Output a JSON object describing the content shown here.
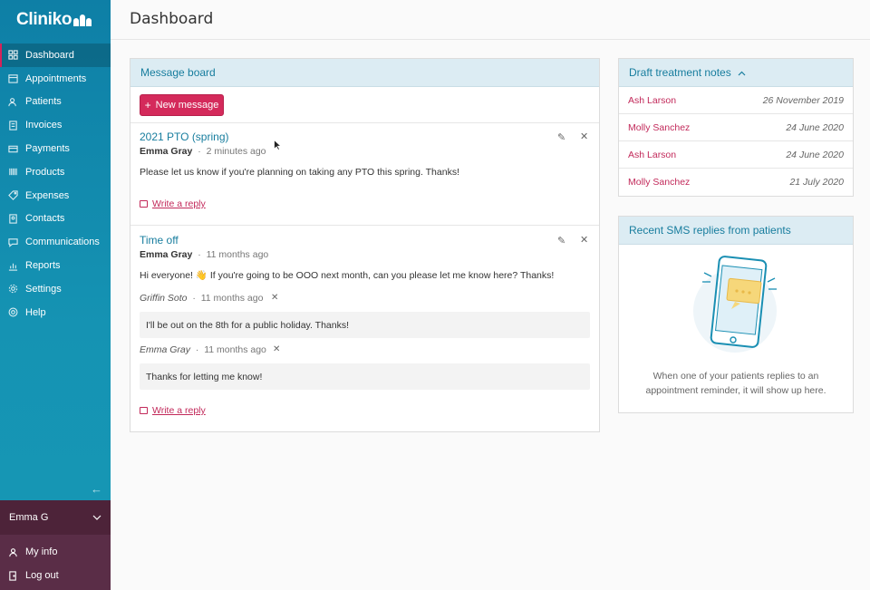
{
  "app": {
    "name": "Cliniko"
  },
  "sidebar": {
    "items": [
      {
        "label": "Dashboard",
        "icon": "grid-icon",
        "active": true
      },
      {
        "label": "Appointments",
        "icon": "calendar-icon"
      },
      {
        "label": "Patients",
        "icon": "users-icon"
      },
      {
        "label": "Invoices",
        "icon": "invoice-icon"
      },
      {
        "label": "Payments",
        "icon": "card-icon"
      },
      {
        "label": "Products",
        "icon": "barcode-icon"
      },
      {
        "label": "Expenses",
        "icon": "tag-icon"
      },
      {
        "label": "Contacts",
        "icon": "contacts-icon"
      },
      {
        "label": "Communications",
        "icon": "chat-icon"
      },
      {
        "label": "Reports",
        "icon": "chart-icon"
      },
      {
        "label": "Settings",
        "icon": "gear-icon"
      },
      {
        "label": "Help",
        "icon": "help-icon"
      }
    ],
    "user": {
      "name": "Emma G",
      "my_info": "My info",
      "logout": "Log out"
    }
  },
  "header": {
    "title": "Dashboard"
  },
  "message_board": {
    "title": "Message board",
    "new_button": "New message",
    "separator": "·",
    "messages": [
      {
        "title": "2021 PTO (spring)",
        "author": "Emma Gray",
        "time": "2 minutes ago",
        "body": "Please let us know if you're planning on taking any PTO this spring. Thanks!",
        "reply_label": "Write a reply"
      },
      {
        "title": "Time off",
        "author": "Emma Gray",
        "time": "11 months ago",
        "body": "Hi everyone! 👋  If you're going to be OOO next month, can you please let me know here? Thanks!",
        "replies": [
          {
            "author": "Griffin Soto",
            "time": "11 months ago",
            "body": "I'll be out on the 8th for a public holiday. Thanks!"
          },
          {
            "author": "Emma Gray",
            "time": "11 months ago",
            "body": "Thanks for letting me know!"
          }
        ],
        "reply_label": "Write a reply"
      }
    ]
  },
  "drafts": {
    "title": "Draft treatment notes",
    "rows": [
      {
        "name": "Ash Larson",
        "date": "26 November 2019"
      },
      {
        "name": "Molly Sanchez",
        "date": "24 June 2020"
      },
      {
        "name": "Ash Larson",
        "date": "24 June 2020"
      },
      {
        "name": "Molly Sanchez",
        "date": "21 July 2020"
      }
    ]
  },
  "sms": {
    "title": "Recent SMS replies from patients",
    "empty_line1": "When one of your patients replies to an",
    "empty_line2": "appointment reminder, it will show up here."
  },
  "colors": {
    "accent": "#d42a5b",
    "brand": "#1593b3",
    "link": "#177d9e",
    "user_bg": "#5a2d47"
  }
}
